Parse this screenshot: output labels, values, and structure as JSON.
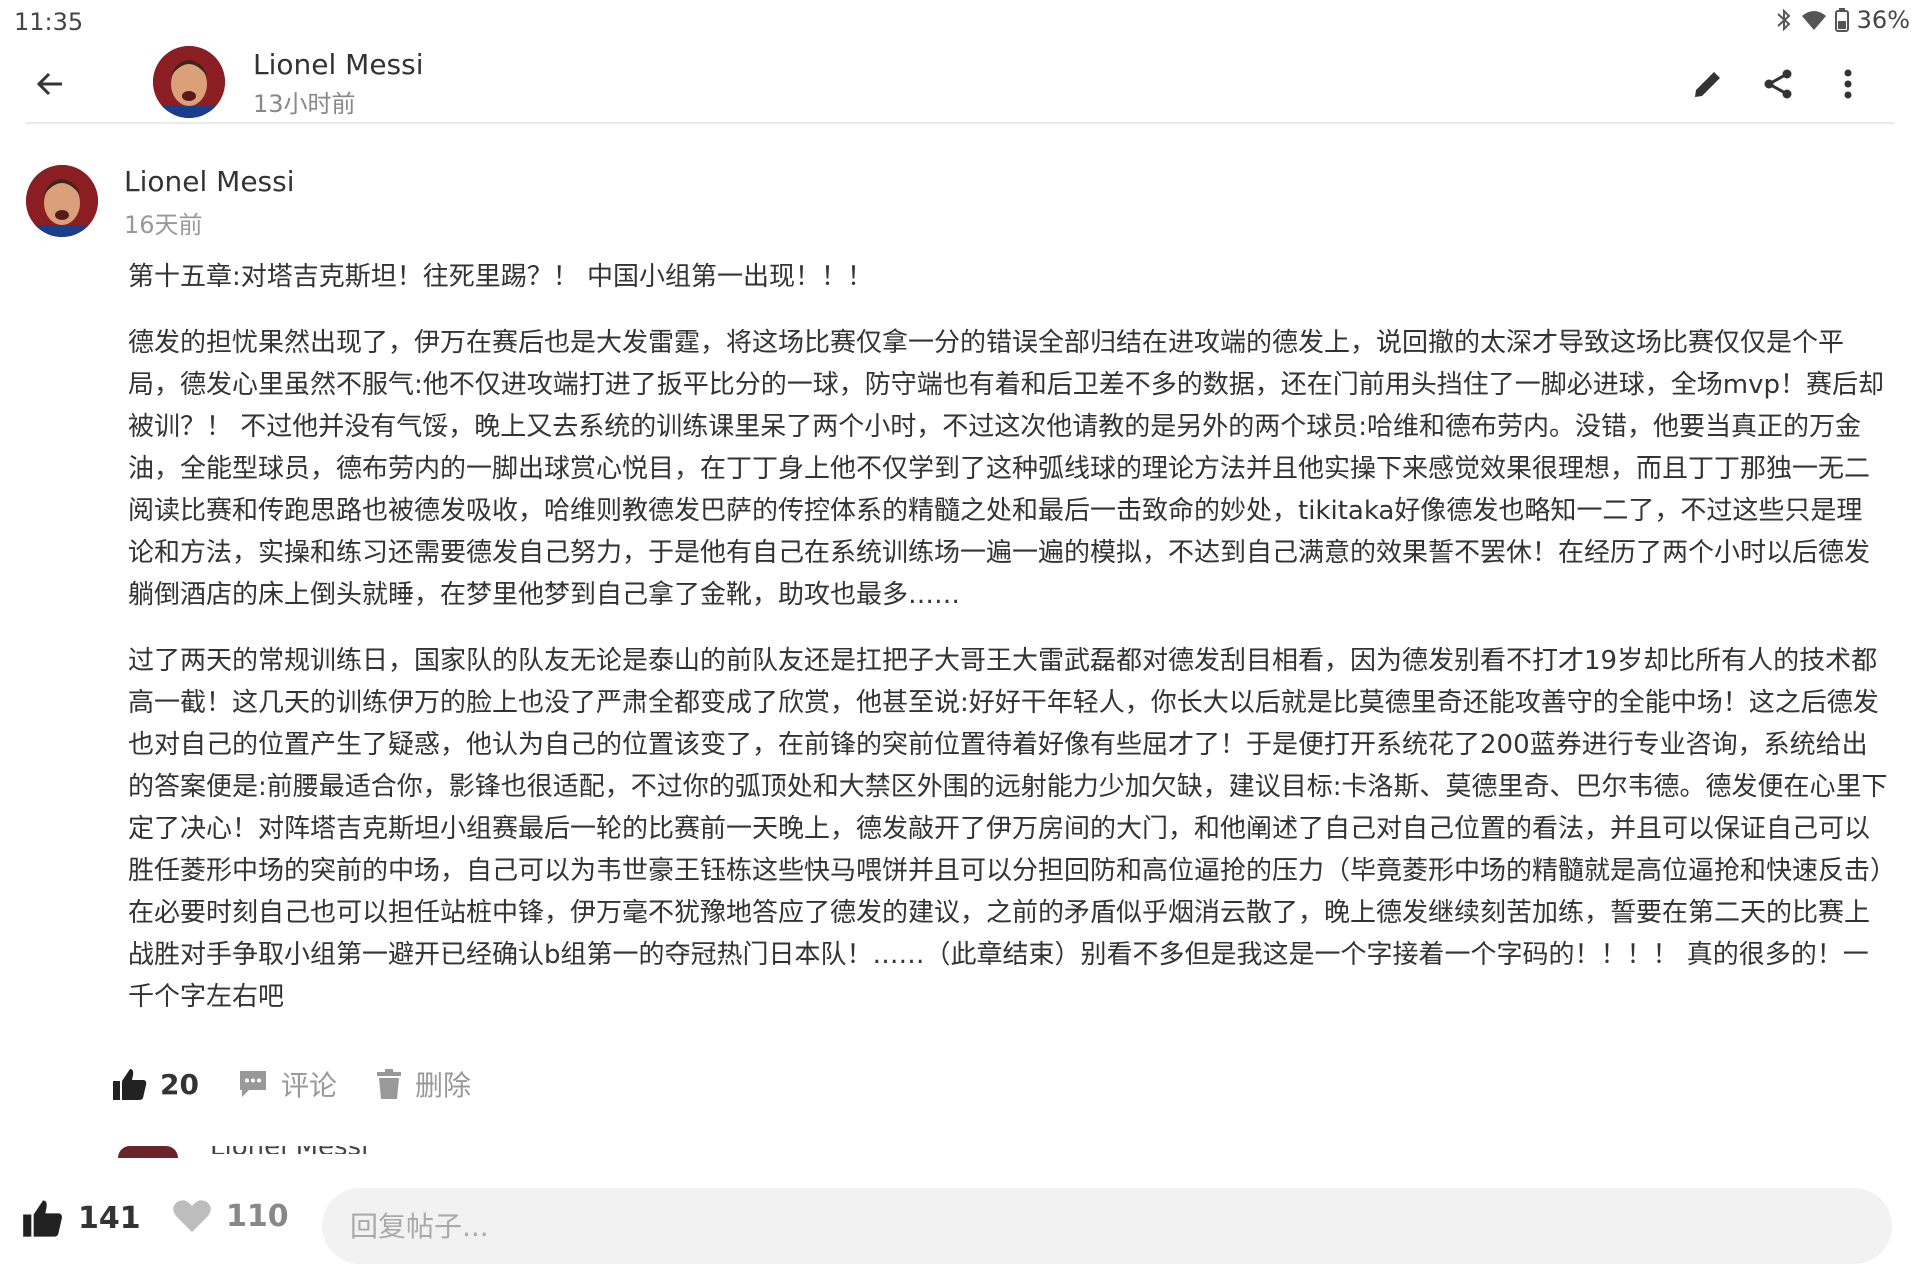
{
  "status_bar": {
    "time": "11:35",
    "battery": "36%",
    "icons": [
      "bluetooth-icon",
      "wifi-icon",
      "battery-icon"
    ]
  },
  "header": {
    "author": "Lionel  Messi",
    "time": "13小时前",
    "actions": [
      "edit-icon",
      "share-icon",
      "more-icon"
    ]
  },
  "post": {
    "author": "Lionel  Messi",
    "time": "16天前",
    "title": "第十五章:对塔吉克斯坦！往死里踢？！ 中国小组第一出现！！！",
    "paragraphs": [
      "德发的担忧果然出现了，伊万在赛后也是大发雷霆，将这场比赛仅拿一分的错误全部归结在进攻端的德发上，说回撤的太深才导致这场比赛仅仅是个平局，德发心里虽然不服气:他不仅进攻端打进了扳平比分的一球，防守端也有着和后卫差不多的数据，还在门前用头挡住了一脚必进球，全场mvp！赛后却被训？！ 不过他并没有气馁，晚上又去系统的训练课里呆了两个小时，不过这次他请教的是另外的两个球员:哈维和德布劳内。没错，他要当真正的万金油，全能型球员，德布劳内的一脚出球赏心悦目，在丁丁身上他不仅学到了这种弧线球的理论方法并且他实操下来感觉效果很理想，而且丁丁那独一无二阅读比赛和传跑思路也被德发吸收，哈维则教德发巴萨的传控体系的精髓之处和最后一击致命的妙处，tikitaka好像德发也略知一二了，不过这些只是理论和方法，实操和练习还需要德发自己努力，于是他有自己在系统训练场一遍一遍的模拟，不达到自己满意的效果誓不罢休！在经历了两个小时以后德发躺倒酒店的床上倒头就睡，在梦里他梦到自己拿了金靴，助攻也最多……",
      "过了两天的常规训练日，国家队的队友无论是泰山的前队友还是扛把子大哥王大雷武磊都对德发刮目相看，因为德发别看不打才19岁却比所有人的技术都高一截！这几天的训练伊万的脸上也没了严肃全都变成了欣赏，他甚至说:好好干年轻人，你长大以后就是比莫德里奇还能攻善守的全能中场！这之后德发也对自己的位置产生了疑惑，他认为自己的位置该变了，在前锋的突前位置待着好像有些屈才了！于是便打开系统花了200蓝券进行专业咨询，系统给出的答案便是:前腰最适合你，影锋也很适配，不过你的弧顶处和大禁区外围的远射能力少加欠缺，建议目标:卡洛斯、莫德里奇、巴尔韦德。德发便在心里下定了决心！对阵塔吉克斯坦小组赛最后一轮的比赛前一天晚上，德发敲开了伊万房间的大门，和他阐述了自己对自己位置的看法，并且可以保证自己可以胜任菱形中场的突前的中场，自己可以为韦世豪王钰栋这些快马喂饼并且可以分担回防和高位逼抢的压力（毕竟菱形中场的精髓就是高位逼抢和快速反击）在必要时刻自己也可以担任站桩中锋，伊万毫不犹豫地答应了德发的建议，之前的矛盾似乎烟消云散了，晚上德发继续刻苦加练，誓要在第二天的比赛上战胜对手争取小组第一避开已经确认b组第一的夺冠热门日本队！……（此章结束）别看不多但是我这是一个字接着一个字码的！！！！ 真的很多的！一千个字左右吧"
    ],
    "likes": "20",
    "comment_label": "评论",
    "delete_label": "删除"
  },
  "next_reply_author": "Lionel  Messi",
  "bottom_bar": {
    "likes": "141",
    "favorites": "110",
    "reply_placeholder": "回复帖子..."
  }
}
